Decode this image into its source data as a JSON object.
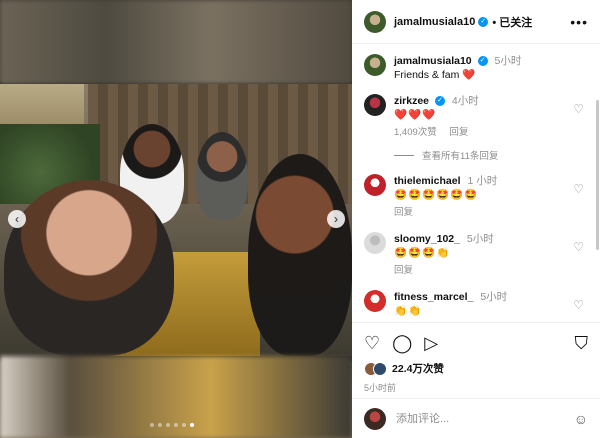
{
  "header": {
    "username": "jamalmusiala10",
    "follow_status": "已关注",
    "more": "•••"
  },
  "caption": {
    "username": "jamalmusiala10",
    "time": "5小时",
    "text": "Friends & fam ❤️"
  },
  "comments": [
    {
      "username": "zirkzee",
      "time": "4小时",
      "text": "❤️❤️❤️",
      "likes": "1,409次赞",
      "reply": "回复",
      "view_replies": "查看所有11条回复"
    },
    {
      "username": "thielemichael",
      "time": "1 小时",
      "text": "🤩🤩🤩🤩🤩🤩",
      "reply": "回复"
    },
    {
      "username": "sloomy_102_",
      "time": "5小时",
      "text": "🤩🤩🤩👏",
      "reply": "回复"
    },
    {
      "username": "fitness_marcel_",
      "time": "5小时",
      "text": "👏👏"
    }
  ],
  "actions": {
    "like_icon": "♡",
    "comment_icon": "◯",
    "share_icon": "▷",
    "bookmark_icon": "⛉"
  },
  "likes": "22.4万次赞",
  "post_time": "5小时前",
  "add_comment": {
    "placeholder": "添加评论...",
    "emoji_icon": "☺"
  },
  "photo": {
    "prev_label": "‹",
    "next_label": "›",
    "slides": 6,
    "active_slide": 5
  },
  "colors": {
    "verified": "#0095f6",
    "heart": "#ed4956",
    "muted": "#8e8e8e"
  }
}
